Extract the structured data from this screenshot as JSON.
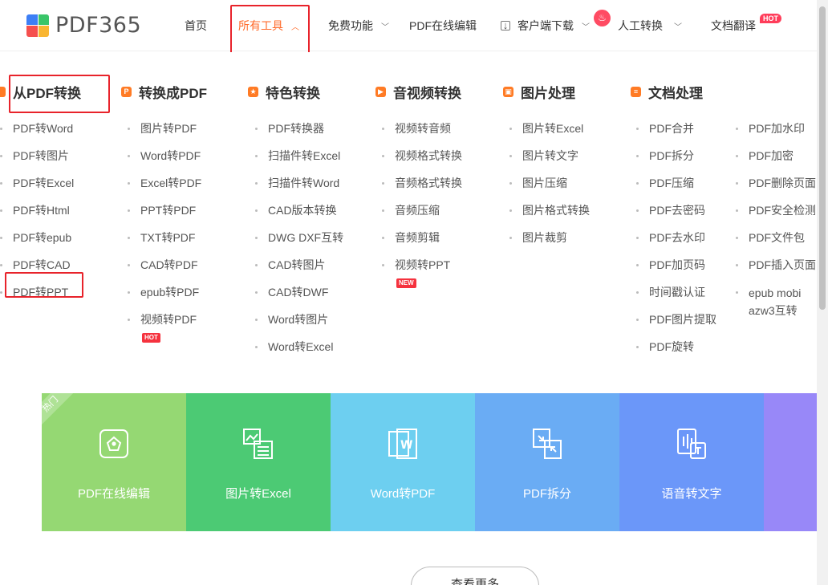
{
  "logo": {
    "text": "PDF365"
  },
  "nav": {
    "home": "首页",
    "all_tools": "所有工具",
    "free": "免费功能",
    "online_edit": "PDF在线编辑",
    "download": "客户端下载",
    "manual": "人工转换",
    "translate": "文档翻译",
    "hot_badge": "HOT"
  },
  "menu": {
    "from_pdf": {
      "title": "从PDF转换",
      "items": [
        "PDF转Word",
        "PDF转图片",
        "PDF转Excel",
        "PDF转Html",
        "PDF转epub",
        "PDF转CAD",
        "PDF转PPT"
      ]
    },
    "to_pdf": {
      "title": "转换成PDF",
      "items": [
        "图片转PDF",
        "Word转PDF",
        "Excel转PDF",
        "PPT转PDF",
        "TXT转PDF",
        "CAD转PDF",
        "epub转PDF",
        "视频转PDF"
      ],
      "badge": "HOT"
    },
    "special": {
      "title": "特色转换",
      "items": [
        "PDF转换器",
        "扫描件转Excel",
        "扫描件转Word",
        "CAD版本转换",
        "DWG DXF互转",
        "CAD转图片",
        "CAD转DWF",
        "Word转图片",
        "Word转Excel"
      ]
    },
    "av": {
      "title": "音视频转换",
      "items": [
        "视频转音频",
        "视频格式转换",
        "音频格式转换",
        "音频压缩",
        "音频剪辑",
        "视频转PPT"
      ],
      "badge": "NEW"
    },
    "image": {
      "title": "图片处理",
      "items": [
        "图片转Excel",
        "图片转文字",
        "图片压缩",
        "图片格式转换",
        "图片裁剪"
      ]
    },
    "doc": {
      "title": "文档处理",
      "items_a": [
        "PDF合并",
        "PDF拆分",
        "PDF压缩",
        "PDF去密码",
        "PDF去水印",
        "PDF加页码",
        "时间戳认证",
        "PDF图片提取",
        "PDF旋转"
      ],
      "items_b": [
        "PDF加水印",
        "PDF加密",
        "PDF删除页面",
        "PDF安全检测",
        "PDF文件包",
        "PDF插入页面",
        "epub mobi azw3互转"
      ]
    }
  },
  "cards": {
    "ribbon": "热门",
    "items": [
      {
        "label": "PDF在线编辑",
        "color": "#95d873",
        "icon": "edit-icon"
      },
      {
        "label": "图片转Excel",
        "color": "#4cca74",
        "icon": "image-excel-icon"
      },
      {
        "label": "Word转PDF",
        "color": "#6dcff0",
        "icon": "word-icon"
      },
      {
        "label": "PDF拆分",
        "color": "#6aacf4",
        "icon": "split-icon"
      },
      {
        "label": "语音转文字",
        "color": "#6b97f9",
        "icon": "voice-text-icon"
      },
      {
        "label": "P",
        "color": "#9888f8",
        "icon": "pdf-icon"
      }
    ]
  },
  "more_button": "查看更多"
}
